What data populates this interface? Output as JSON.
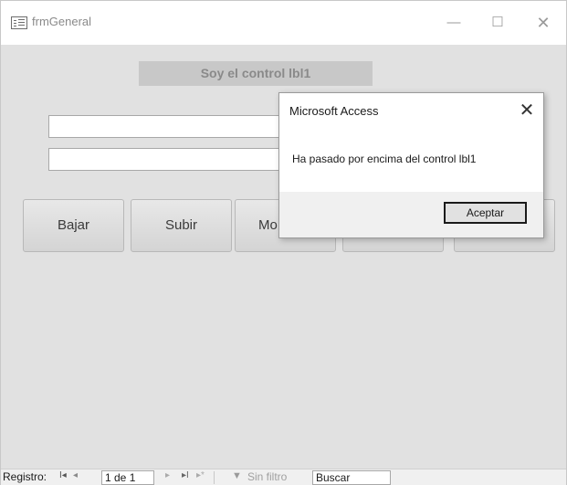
{
  "window": {
    "title": "frmGeneral",
    "minimize_glyph": "—",
    "maximize_glyph": "☐",
    "close_glyph": "✕",
    "icon": "form-icon"
  },
  "form": {
    "label_text": "Soy el control lbl1",
    "textboxes": [
      {
        "value": ""
      },
      {
        "value": ""
      }
    ],
    "buttons": [
      {
        "label": "Bajar"
      },
      {
        "label": "Subir"
      },
      {
        "label": "Mo"
      },
      {
        "label": ""
      },
      {
        "label": ""
      }
    ]
  },
  "dialog": {
    "title": "Microsoft Access",
    "close_glyph": "✕",
    "message": "Ha pasado por encima del control lbl1",
    "ok_label": "Aceptar"
  },
  "navigation": {
    "label": "Registro:",
    "first_glyph": "I◂",
    "prev_glyph": "◂",
    "record": "1 de 1",
    "next_glyph": "▸",
    "last_glyph": "▸I",
    "new_glyph": "▸*",
    "filter_icon": "filter-icon",
    "filter_glyph": "▼",
    "filter_label": "Sin filtro",
    "search_value": "Buscar"
  },
  "colors": {
    "form_background": "#e1e1e1",
    "label_background": "#c8c8c8",
    "dialog_footer": "#f0f0f0"
  }
}
